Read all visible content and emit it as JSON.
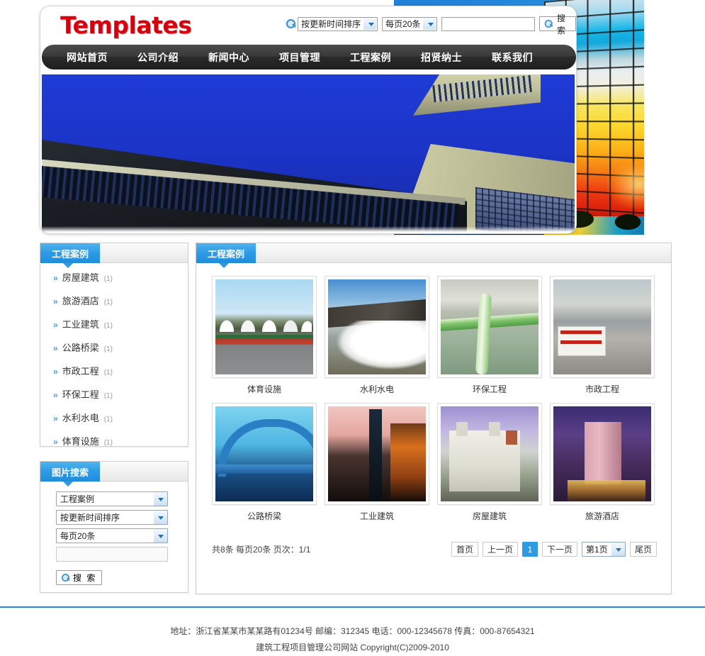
{
  "header": {
    "logo": "Templates",
    "search": {
      "icon": "search-icon",
      "sort_value": "按更新时间排序",
      "perpage_value": "每页20条",
      "keyword_value": "",
      "keyword_placeholder": "",
      "button_label": "搜 索"
    }
  },
  "nav": {
    "items": [
      {
        "label": "网站首页"
      },
      {
        "label": "公司介绍"
      },
      {
        "label": "新闻中心"
      },
      {
        "label": "项目管理"
      },
      {
        "label": "工程案例"
      },
      {
        "label": "招贤纳士"
      },
      {
        "label": "联系我们"
      }
    ]
  },
  "banner": {
    "alt": "skyscraper-looking-up-banner"
  },
  "sidebar": {
    "category_panel": {
      "title": "工程案例",
      "items": [
        {
          "arrow": "»",
          "label": "房屋建筑",
          "count": "(1)"
        },
        {
          "arrow": "»",
          "label": "旅游酒店",
          "count": "(1)"
        },
        {
          "arrow": "»",
          "label": "工业建筑",
          "count": "(1)"
        },
        {
          "arrow": "»",
          "label": "公路桥梁",
          "count": "(1)"
        },
        {
          "arrow": "»",
          "label": "市政工程",
          "count": "(1)"
        },
        {
          "arrow": "»",
          "label": "环保工程",
          "count": "(1)"
        },
        {
          "arrow": "»",
          "label": "水利水电",
          "count": "(1)"
        },
        {
          "arrow": "»",
          "label": "体育设施",
          "count": "(1)"
        }
      ]
    },
    "search_panel": {
      "title": "图片搜索",
      "category_value": "工程案例",
      "sort_value": "按更新时间排序",
      "perpage_value": "每页20条",
      "keyword_value": "",
      "keyword_placeholder": "",
      "button_label": "搜 索"
    }
  },
  "main": {
    "title": "工程案例",
    "thumbnails": [
      {
        "caption": "体育设施",
        "art": "t-sports"
      },
      {
        "caption": "水利水电",
        "art": "t-dam"
      },
      {
        "caption": "环保工程",
        "art": "t-env"
      },
      {
        "caption": "市政工程",
        "art": "t-muni"
      },
      {
        "caption": "公路桥梁",
        "art": "t-bridge"
      },
      {
        "caption": "工业建筑",
        "art": "t-indus"
      },
      {
        "caption": "房屋建筑",
        "art": "t-house"
      },
      {
        "caption": "旅游酒店",
        "art": "t-hotel"
      }
    ],
    "pagination": {
      "info": "共8条 每页20条 页次：1/1",
      "first": "首页",
      "prev": "上一页",
      "current": "1",
      "next": "下一页",
      "jump_value": "第1页",
      "last": "尾页"
    }
  },
  "footer": {
    "line1": "地址：浙江省某某市某某路有01234号 邮编：312345 电话：000-12345678 传真：000-87654321",
    "line2": "建筑工程项目管理公司网站 Copyright(C)2009-2010"
  },
  "colors": {
    "brand_red": "#d6000f",
    "accent_blue": "#2e9ae4",
    "nav_dark": "#2b2b2b",
    "footer_rule": "#1f8ddc"
  }
}
